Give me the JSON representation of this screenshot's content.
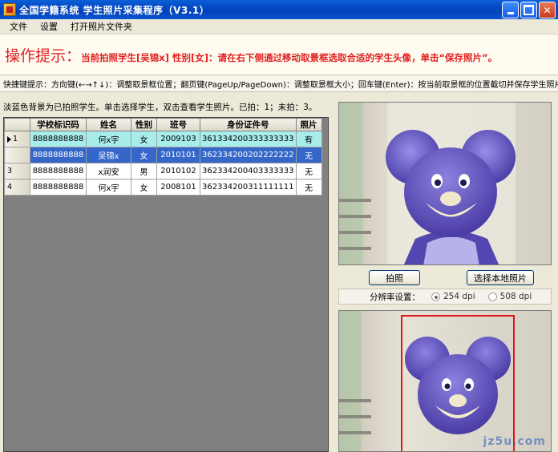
{
  "window": {
    "title": "全国学籍系统  学生照片采集程序（V3.1）"
  },
  "menu": [
    {
      "label": "文件"
    },
    {
      "label": "设置"
    },
    {
      "label": "打开照片文件夹"
    }
  ],
  "hint": {
    "title": "操作提示：",
    "text": "当前拍照学生[吴锦x] 性别[女]：请在右下侧通过移动取景框选取合适的学生头像，单击“保存照片”。"
  },
  "shortcuts": {
    "label": "快捷键提示：",
    "text": "方向键(←→↑↓)：调整取景框位置；翻页键(PageUp/PageDown)：调整取景框大小；回车键(Enter)：按当前取景框的位置截切并保存学生照片。"
  },
  "legend_note": "淡蓝色背景为已拍照学生。单击选择学生，双击查看学生照片。已拍：1；未拍：3。",
  "table": {
    "columns": [
      "学校标识码",
      "姓名",
      "性别",
      "班号",
      "身份证件号",
      "照片"
    ],
    "rows": [
      {
        "num": "1",
        "school_id": "8888888888",
        "name": "何x宇",
        "gender": "女",
        "class": "2009103",
        "id_number": "361334200333333333",
        "photo": "有"
      },
      {
        "num": "",
        "school_id": "8888888888",
        "name": "吴锦x",
        "gender": "女",
        "class": "2010101",
        "id_number": "362334200202222222",
        "photo": "无"
      },
      {
        "num": "3",
        "school_id": "8888888888",
        "name": "x润安",
        "gender": "男",
        "class": "2010102",
        "id_number": "362334200403333333",
        "photo": "无"
      },
      {
        "num": "4",
        "school_id": "8888888888",
        "name": "何x宇",
        "gender": "女",
        "class": "2008101",
        "id_number": "362334200311111111",
        "photo": "无"
      }
    ]
  },
  "buttons": {
    "shoot": "拍照",
    "local_photo": "选择本地照片"
  },
  "resolution": {
    "label": "分辨率设置：",
    "options": [
      "254 dpi",
      "508 dpi"
    ],
    "selected": "254 dpi"
  },
  "watermark": "jz5u.com",
  "colors": {
    "titlebar": "#0449c2",
    "hint_red": "#e02020",
    "row_photographed": "#a8ecec",
    "row_selected": "#3567c8",
    "viewfinder": "#e01818"
  }
}
